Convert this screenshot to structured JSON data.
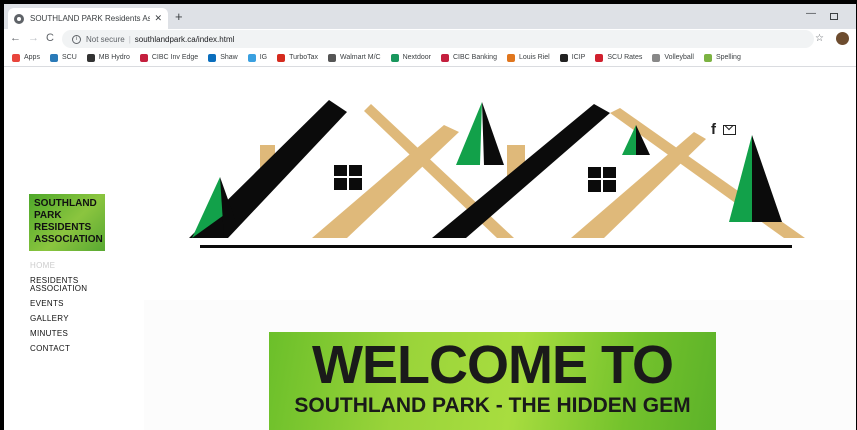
{
  "browser": {
    "tab_title": "SOUTHLAND PARK Residents As",
    "tab_close": "✕",
    "new_tab": "+",
    "minimize": "—",
    "back": "←",
    "forward": "→",
    "reload": "C",
    "security_text": "Not secure",
    "separator": "|",
    "url": "southlandpark.ca/index.html",
    "star": "☆",
    "bookmarks": [
      {
        "label": "Apps",
        "color": "#e8453c"
      },
      {
        "label": "SCU",
        "color": "#2a7ab8"
      },
      {
        "label": "MB Hydro",
        "color": "#333333"
      },
      {
        "label": "CIBC Inv Edge",
        "color": "#c41f3e"
      },
      {
        "label": "Shaw",
        "color": "#0a6ebd"
      },
      {
        "label": "IG",
        "color": "#3aa0e0"
      },
      {
        "label": "TurboTax",
        "color": "#d52b1e"
      },
      {
        "label": "Walmart M/C",
        "color": "#555555"
      },
      {
        "label": "Nextdoor",
        "color": "#19975d"
      },
      {
        "label": "CIBC Banking",
        "color": "#c41f3e"
      },
      {
        "label": "Louis Riel",
        "color": "#e0761e"
      },
      {
        "label": "ICIP",
        "color": "#222222"
      },
      {
        "label": "SCU Rates",
        "color": "#d0202e"
      },
      {
        "label": "Volleyball",
        "color": "#888888"
      },
      {
        "label": "Spelling",
        "color": "#7cb342"
      }
    ]
  },
  "site": {
    "logo_lines": [
      "SOUTHLAND",
      "PARK",
      "RESIDENTS",
      "ASSOCIATION"
    ],
    "menu": [
      {
        "label": "HOME",
        "active": true
      },
      {
        "label": "RESIDENTS ASSOCIATION",
        "active": false
      },
      {
        "label": "EVENTS",
        "active": false
      },
      {
        "label": "GALLERY",
        "active": false
      },
      {
        "label": "MINUTES",
        "active": false
      },
      {
        "label": "CONTACT",
        "active": false
      }
    ],
    "social": {
      "facebook": "f"
    },
    "banner": {
      "title": "WELCOME TO",
      "subtitle": "SOUTHLAND PARK - THE HIDDEN GEM"
    }
  },
  "colors": {
    "roof_black": "#0b0b0b",
    "roof_tan": "#dfb97a",
    "tree_green": "#12a14a",
    "accent_green": "#8bc53f"
  }
}
